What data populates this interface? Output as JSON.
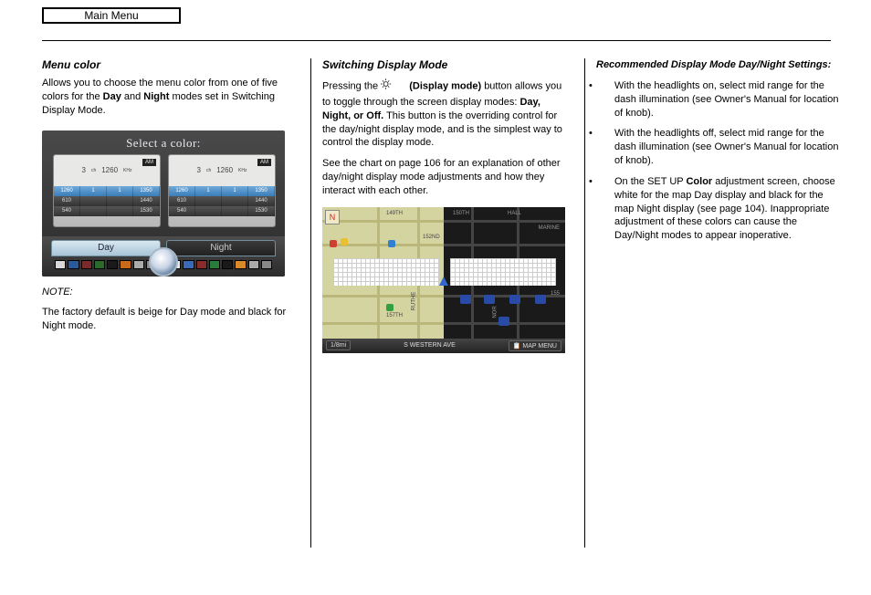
{
  "header": {
    "main_menu_label": "Main Menu"
  },
  "col1": {
    "heading": "Menu color",
    "para1_a": "Allows you to choose the menu color from one of five colors for the ",
    "para1_day": "Day",
    "para1_and": " and ",
    "para1_night": "Night",
    "para1_b": " modes set in Switching Display Mode.",
    "shot": {
      "title": "Select a color:",
      "am_badge": "AM",
      "freq_ch": "3",
      "ch_suffix": "ch",
      "freq_val": "1260",
      "freq_unit": "KHz",
      "row_hl": [
        "1260",
        "1",
        "1",
        "1350"
      ],
      "row_a": [
        "610",
        "",
        "",
        "1440"
      ],
      "row_b": [
        "540",
        "",
        "",
        "1530"
      ],
      "tab_day": "Day",
      "tab_night": "Night",
      "day_swatches": [
        "#d8d8d8",
        "#2a5a9a",
        "#7a2a2a",
        "#2a6a2a",
        "#1a1a1a",
        "#c86a1a",
        "#bbbbbb",
        "#888"
      ],
      "night_swatches": [
        "#e8e8e8",
        "#3a6ab8",
        "#8a2a2a",
        "#2a7a3a",
        "#1a1a1a",
        "#d88a2a",
        "#bbbbbb",
        "#888"
      ]
    },
    "note_label": "NOTE:",
    "note_text": "The factory default is beige for Day mode and black for Night mode."
  },
  "col2": {
    "heading": "Switching Display Mode",
    "p1_a": "Pressing the ",
    "display_mode_label": " (Display mode)",
    "p1_b": " button allows you to toggle through the screen display modes: ",
    "modes": "Day, Night, or Off.",
    "p1_c": " This button is the overriding control for the day/night display mode, and is the simplest way to control the display mode.",
    "p2": "See the chart on page 106 for an explanation of other day/night display mode adjustments and how they interact with each other.",
    "map": {
      "compass": "N",
      "streets_day": [
        "149TH",
        "152ND",
        "RUTHE",
        "157TH"
      ],
      "streets_night": [
        "150TH",
        "MARINE",
        "HALL",
        "155",
        "NOR"
      ],
      "scale": "1/8mi",
      "bottom_street": "S WESTERN AVE",
      "map_menu": "MAP MENU",
      "white_left": "Day",
      "white_right": "Night"
    }
  },
  "col3": {
    "heading": "Recommended Display Mode Day/Night Settings:",
    "b1": "With the headlights on, select mid range for the dash illumination (see Owner's Manual for location of knob).",
    "b2": "With the headlights off, select mid range for the dash illumination (see Owner's Manual for location of knob).",
    "b3_a": "On the SET UP ",
    "b3_b": "Color",
    "b3_c": " adjustment screen, choose white for the map Day display and black for the map Night display (see page 104). Inappropriate adjustment of these colors can cause the Day/Night modes to appear inoperative."
  }
}
